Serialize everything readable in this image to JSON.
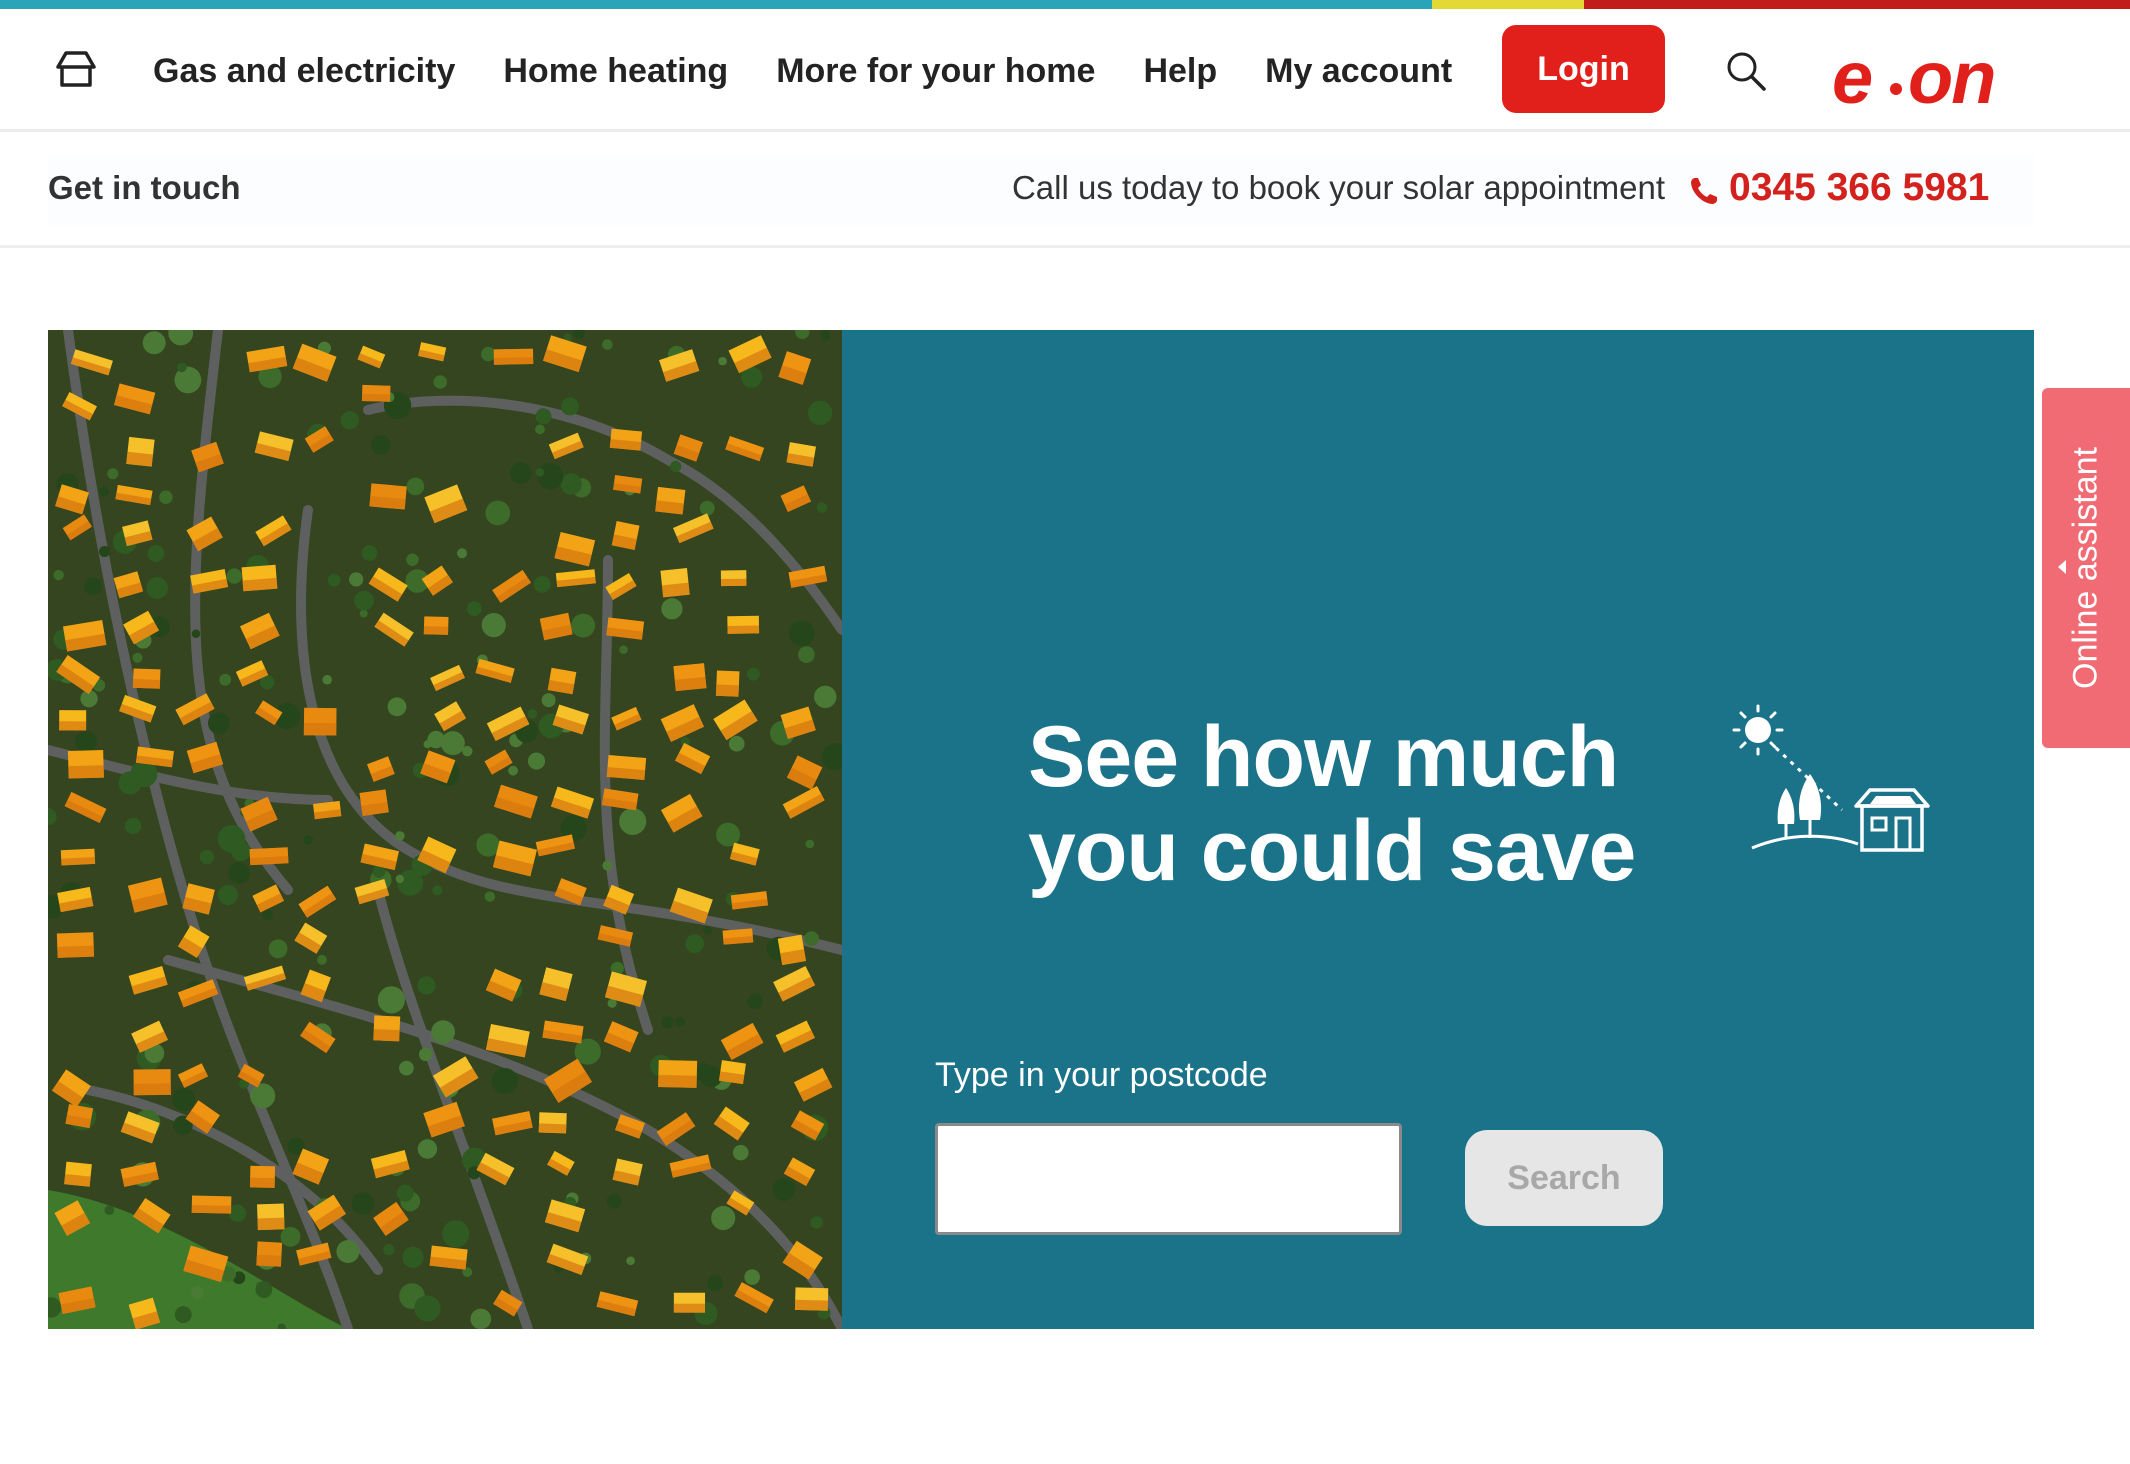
{
  "colors": {
    "stripe": [
      "#2aa4b9",
      "#e3d934",
      "#c11d1a"
    ],
    "brand_red": "#e2201b",
    "hero_panel": "#1b7389",
    "assistant_tab": "#f16b74"
  },
  "header": {
    "home_icon": "home-icon",
    "nav": [
      {
        "label": "Gas and electricity"
      },
      {
        "label": "Home heating"
      },
      {
        "label": "More for your home"
      },
      {
        "label": "Help"
      },
      {
        "label": "My account"
      }
    ],
    "login_label": "Login",
    "search_icon": "search-icon",
    "logo_text": "e·on"
  },
  "subbar": {
    "get_in_touch": "Get in touch",
    "call_text": "Call us today to book your solar appointment",
    "phone_icon": "phone-icon",
    "phone_number": "0345 366 5981"
  },
  "hero": {
    "title_line1": "See how much",
    "title_line2": "you could save",
    "illustration_icon": "sun-trees-house-icon",
    "postcode_label": "Type in your postcode",
    "postcode_value": "",
    "search_label": "Search"
  },
  "assistant": {
    "label": "Online assistant"
  }
}
